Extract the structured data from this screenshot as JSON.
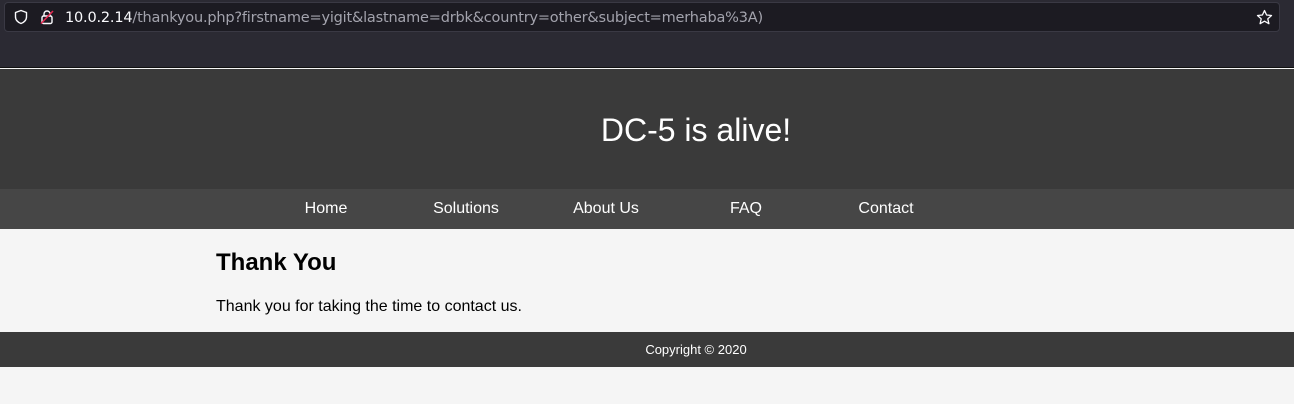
{
  "browser": {
    "url_host": "10.0.2.14",
    "url_path": "/thankyou.php?firstname=yigit&lastname=drbk&country=other&subject=merhaba%3A)",
    "icons": [
      "shield-icon",
      "lock-icon",
      "star-icon"
    ]
  },
  "header": {
    "title": "DC-5 is alive!"
  },
  "nav": {
    "items": [
      {
        "label": "Home"
      },
      {
        "label": "Solutions"
      },
      {
        "label": "About Us"
      },
      {
        "label": "FAQ"
      },
      {
        "label": "Contact"
      }
    ]
  },
  "main": {
    "heading": "Thank You",
    "message": "Thank you for taking the time to contact us."
  },
  "footer": {
    "copyright": "Copyright © 2020"
  },
  "colors": {
    "header_bg": "#3a3a3a",
    "nav_bg": "#464646",
    "page_bg": "#f5f5f5",
    "browser_bg": "#2b2a33"
  }
}
